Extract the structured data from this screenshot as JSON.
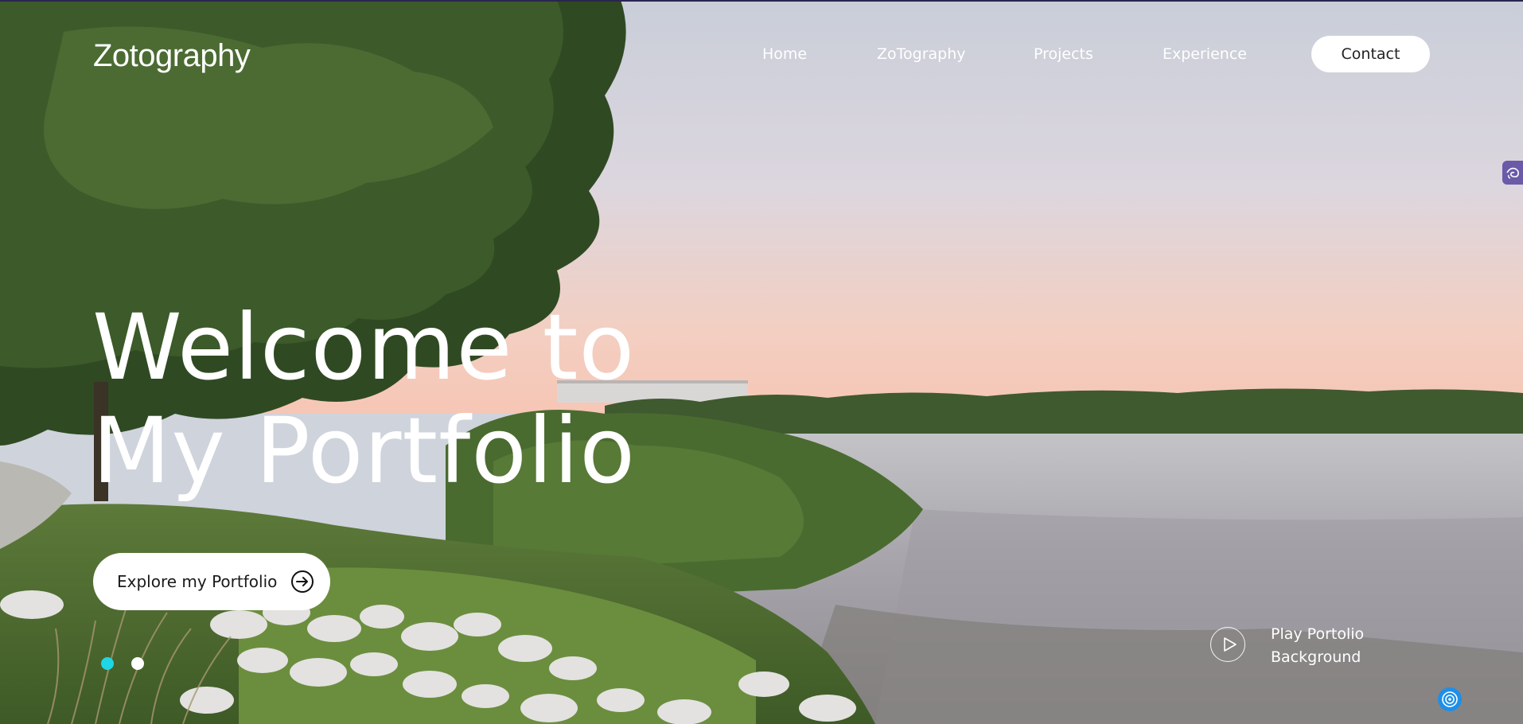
{
  "brand": {
    "logo": "Zotography"
  },
  "nav": {
    "items": [
      {
        "label": "Home"
      },
      {
        "label": "ZoTography"
      },
      {
        "label": "Projects"
      },
      {
        "label": "Experience"
      }
    ],
    "contact_label": "Contact"
  },
  "hero": {
    "title_line1": "Welcome to",
    "title_line2": "My Portfolio",
    "cta_label": "Explore my Portfolio",
    "cta_icon": "arrow-right-circle-icon"
  },
  "slider": {
    "dots": 2,
    "active_index": 0,
    "active_color": "#1fd6e6",
    "inactive_color": "#ffffff"
  },
  "background_video": {
    "label_line1": "Play Portolio",
    "label_line2": "Background",
    "icon": "play-icon"
  },
  "widgets": {
    "side_tab_icon": "accessibility-icon",
    "floating_icon": "assistant-icon"
  },
  "colors": {
    "accent": "#1fd6e6",
    "side_tab": "#6a5aa8",
    "floating": "#1e8fe8"
  }
}
